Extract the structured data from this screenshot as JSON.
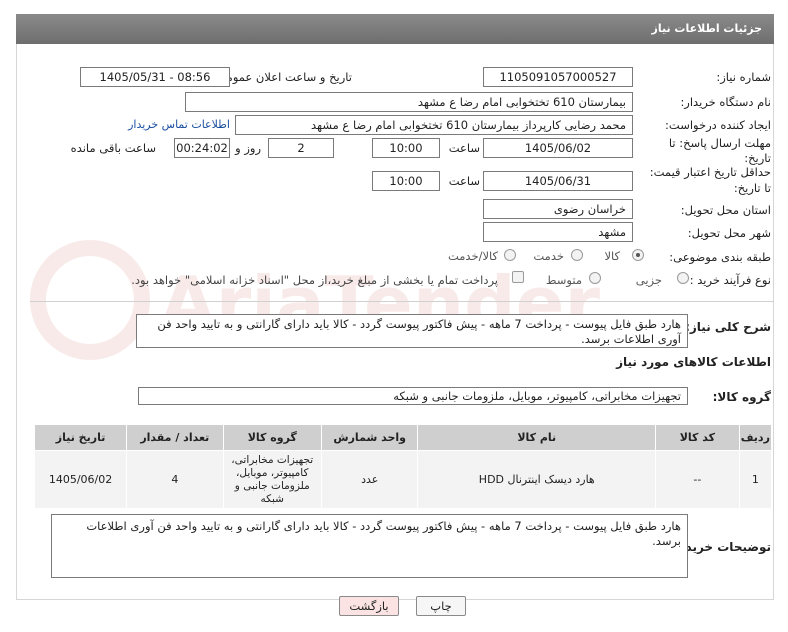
{
  "header": {
    "title": "جزئیات اطلاعات نیاز"
  },
  "fields": {
    "need_number_label": "شماره نیاز:",
    "need_number": "1105091057000527",
    "announce_label": "تاریخ و ساعت اعلان عمومی:",
    "announce_value": "1405/05/31 - 08:56",
    "buyer_org_label": "نام دستگاه خریدار:",
    "buyer_org": "بیمارستان 610 تختخوابی امام رضا ع  مشهد",
    "creator_label": "ایجاد کننده درخواست:",
    "creator": "محمد رضایی کارپرداز بیمارستان 610 تختخوابی امام رضا ع  مشهد",
    "contact_link": "اطلاعات تماس خریدار",
    "deadline_label_1": "مهلت ارسال پاسخ: تا",
    "deadline_label_2": "تاریخ:",
    "deadline_date": "1405/06/02",
    "time_label": "ساعت",
    "deadline_time": "10:00",
    "days_value": "2",
    "days_label": "روز و",
    "remaining_time": "00:24:02",
    "remaining_label": "ساعت باقی مانده",
    "validity_label_1": "حداقل تاریخ اعتبار قیمت:",
    "validity_label_2": "تا تاریخ:",
    "validity_date": "1405/06/31",
    "validity_time": "10:00",
    "province_label": "استان محل تحویل:",
    "province": "خراسان رضوی",
    "city_label": "شهر محل تحویل:",
    "city": "مشهد",
    "category_label": "طبقه بندی موضوعی:",
    "category_options": [
      "کالا",
      "خدمت",
      "کالا/خدمت"
    ],
    "process_label": "نوع فرآیند خرید :",
    "process_options": [
      "جزیی",
      "متوسط"
    ],
    "payment_note": "پرداخت تمام یا بخشی از مبلغ خرید،از محل \"اسناد خزانه اسلامی\" خواهد بود."
  },
  "summary": {
    "label": "شرح کلی نیاز:",
    "text": "هارد طبق فایل پیوست - پرداخت 7 ماهه - پیش فاکتور پیوست گردد - کالا باید دارای گارانتی و به تایید واحد فن آوری اطلاعات برسد."
  },
  "goods": {
    "section_title": "اطلاعات کالاهای مورد نیاز",
    "group_label": "گروه کالا:",
    "group_value": "تجهیزات مخابراتی، کامپیوتر، موبایل، ملزومات جانبی و شبکه",
    "columns": [
      "ردیف",
      "کد کالا",
      "نام کالا",
      "واحد شمارش",
      "گروه کالا",
      "تعداد / مقدار",
      "تاریخ نیاز"
    ],
    "rows": [
      [
        "1",
        "--",
        "هارد دیسک اینترنال HDD",
        "عدد",
        "تجهیزات مخابراتی، کامپیوتر، موبایل، ملزومات جانبی و شبکه",
        "4",
        "1405/06/02"
      ]
    ]
  },
  "buyer_notes": {
    "label": "توضیحات خریدار:",
    "text": "هارد طبق فایل پیوست - پرداخت 7 ماهه - پیش فاکتور پیوست گردد - کالا باید دارای گارانتی و به تایید واحد فن آوری اطلاعات برسد."
  },
  "buttons": {
    "print": "چاپ",
    "back": "بازگشت"
  },
  "watermark": {
    "text": "AriaTender.net"
  },
  "colors": {
    "header": "#7a7a7a",
    "link": "#1a4fa0",
    "back_button": "#fbe3e3",
    "print_button": "#f6f6f6",
    "watermark": "#c0392b"
  }
}
